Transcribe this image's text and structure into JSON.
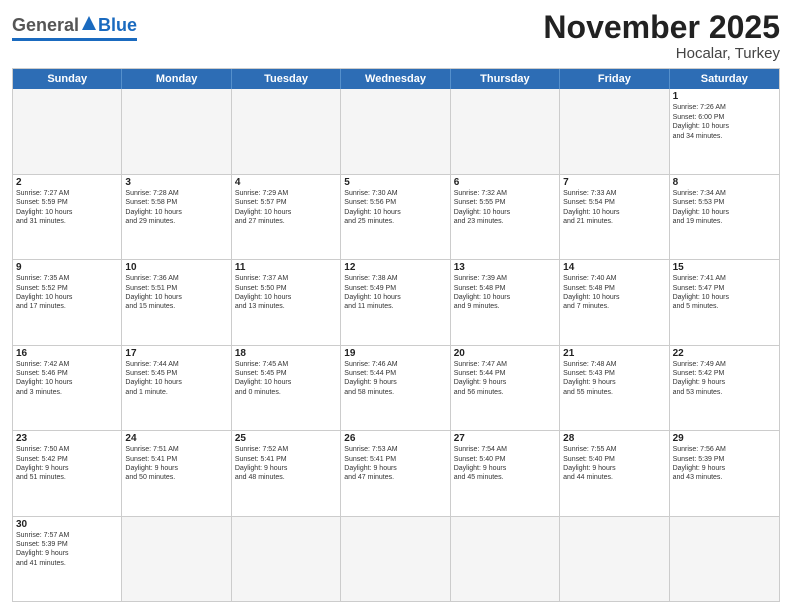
{
  "header": {
    "logo": {
      "part1": "General",
      "part2": "Blue"
    },
    "title": "November 2025",
    "location": "Hocalar, Turkey"
  },
  "weekdays": [
    "Sunday",
    "Monday",
    "Tuesday",
    "Wednesday",
    "Thursday",
    "Friday",
    "Saturday"
  ],
  "weeks": [
    [
      {
        "day": "",
        "empty": true
      },
      {
        "day": "",
        "empty": true
      },
      {
        "day": "",
        "empty": true
      },
      {
        "day": "",
        "empty": true
      },
      {
        "day": "",
        "empty": true
      },
      {
        "day": "",
        "empty": true
      },
      {
        "day": "1",
        "info": "Sunrise: 7:26 AM\nSunset: 6:00 PM\nDaylight: 10 hours\nand 34 minutes."
      }
    ],
    [
      {
        "day": "2",
        "info": "Sunrise: 7:27 AM\nSunset: 5:59 PM\nDaylight: 10 hours\nand 31 minutes."
      },
      {
        "day": "3",
        "info": "Sunrise: 7:28 AM\nSunset: 5:58 PM\nDaylight: 10 hours\nand 29 minutes."
      },
      {
        "day": "4",
        "info": "Sunrise: 7:29 AM\nSunset: 5:57 PM\nDaylight: 10 hours\nand 27 minutes."
      },
      {
        "day": "5",
        "info": "Sunrise: 7:30 AM\nSunset: 5:56 PM\nDaylight: 10 hours\nand 25 minutes."
      },
      {
        "day": "6",
        "info": "Sunrise: 7:32 AM\nSunset: 5:55 PM\nDaylight: 10 hours\nand 23 minutes."
      },
      {
        "day": "7",
        "info": "Sunrise: 7:33 AM\nSunset: 5:54 PM\nDaylight: 10 hours\nand 21 minutes."
      },
      {
        "day": "8",
        "info": "Sunrise: 7:34 AM\nSunset: 5:53 PM\nDaylight: 10 hours\nand 19 minutes."
      }
    ],
    [
      {
        "day": "9",
        "info": "Sunrise: 7:35 AM\nSunset: 5:52 PM\nDaylight: 10 hours\nand 17 minutes."
      },
      {
        "day": "10",
        "info": "Sunrise: 7:36 AM\nSunset: 5:51 PM\nDaylight: 10 hours\nand 15 minutes."
      },
      {
        "day": "11",
        "info": "Sunrise: 7:37 AM\nSunset: 5:50 PM\nDaylight: 10 hours\nand 13 minutes."
      },
      {
        "day": "12",
        "info": "Sunrise: 7:38 AM\nSunset: 5:49 PM\nDaylight: 10 hours\nand 11 minutes."
      },
      {
        "day": "13",
        "info": "Sunrise: 7:39 AM\nSunset: 5:48 PM\nDaylight: 10 hours\nand 9 minutes."
      },
      {
        "day": "14",
        "info": "Sunrise: 7:40 AM\nSunset: 5:48 PM\nDaylight: 10 hours\nand 7 minutes."
      },
      {
        "day": "15",
        "info": "Sunrise: 7:41 AM\nSunset: 5:47 PM\nDaylight: 10 hours\nand 5 minutes."
      }
    ],
    [
      {
        "day": "16",
        "info": "Sunrise: 7:42 AM\nSunset: 5:46 PM\nDaylight: 10 hours\nand 3 minutes."
      },
      {
        "day": "17",
        "info": "Sunrise: 7:44 AM\nSunset: 5:45 PM\nDaylight: 10 hours\nand 1 minute."
      },
      {
        "day": "18",
        "info": "Sunrise: 7:45 AM\nSunset: 5:45 PM\nDaylight: 10 hours\nand 0 minutes."
      },
      {
        "day": "19",
        "info": "Sunrise: 7:46 AM\nSunset: 5:44 PM\nDaylight: 9 hours\nand 58 minutes."
      },
      {
        "day": "20",
        "info": "Sunrise: 7:47 AM\nSunset: 5:44 PM\nDaylight: 9 hours\nand 56 minutes."
      },
      {
        "day": "21",
        "info": "Sunrise: 7:48 AM\nSunset: 5:43 PM\nDaylight: 9 hours\nand 55 minutes."
      },
      {
        "day": "22",
        "info": "Sunrise: 7:49 AM\nSunset: 5:42 PM\nDaylight: 9 hours\nand 53 minutes."
      }
    ],
    [
      {
        "day": "23",
        "info": "Sunrise: 7:50 AM\nSunset: 5:42 PM\nDaylight: 9 hours\nand 51 minutes."
      },
      {
        "day": "24",
        "info": "Sunrise: 7:51 AM\nSunset: 5:41 PM\nDaylight: 9 hours\nand 50 minutes."
      },
      {
        "day": "25",
        "info": "Sunrise: 7:52 AM\nSunset: 5:41 PM\nDaylight: 9 hours\nand 48 minutes."
      },
      {
        "day": "26",
        "info": "Sunrise: 7:53 AM\nSunset: 5:41 PM\nDaylight: 9 hours\nand 47 minutes."
      },
      {
        "day": "27",
        "info": "Sunrise: 7:54 AM\nSunset: 5:40 PM\nDaylight: 9 hours\nand 45 minutes."
      },
      {
        "day": "28",
        "info": "Sunrise: 7:55 AM\nSunset: 5:40 PM\nDaylight: 9 hours\nand 44 minutes."
      },
      {
        "day": "29",
        "info": "Sunrise: 7:56 AM\nSunset: 5:39 PM\nDaylight: 9 hours\nand 43 minutes."
      }
    ],
    [
      {
        "day": "30",
        "info": "Sunrise: 7:57 AM\nSunset: 5:39 PM\nDaylight: 9 hours\nand 41 minutes."
      },
      {
        "day": "",
        "empty": true
      },
      {
        "day": "",
        "empty": true
      },
      {
        "day": "",
        "empty": true
      },
      {
        "day": "",
        "empty": true
      },
      {
        "day": "",
        "empty": true
      },
      {
        "day": "",
        "empty": true
      }
    ]
  ]
}
